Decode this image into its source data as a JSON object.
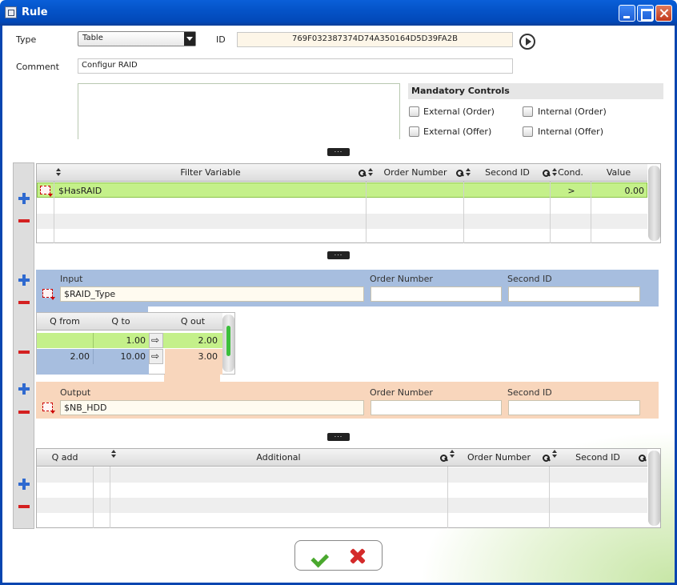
{
  "window": {
    "title": "Rule"
  },
  "form": {
    "type_label": "Type",
    "type_value": "Table",
    "id_label": "ID",
    "id_value": "769F032387374D74A350164D5D39FA2B",
    "comment_label": "Comment",
    "comment_value": "Configur RAID"
  },
  "mandatory": {
    "title": "Mandatory Controls",
    "options": [
      "External (Order)",
      "Internal (Order)",
      "External (Offer)",
      "Internal (Offer)"
    ]
  },
  "filter_grid": {
    "headers": [
      "Filter Variable",
      "Order Number",
      "Second ID",
      "Cond.",
      "Value"
    ],
    "rows": [
      {
        "variable": "$HasRAID",
        "order": "",
        "second": "",
        "cond": ">",
        "value": "0.00"
      }
    ]
  },
  "input_panel": {
    "input_label": "Input",
    "order_label": "Order Number",
    "second_label": "Second ID",
    "input_value": "$RAID_Type"
  },
  "q_table": {
    "headers": [
      "Q from",
      "Q to",
      "Q out"
    ],
    "rows": [
      {
        "from": "",
        "to": "1.00",
        "out": "2.00"
      },
      {
        "from": "2.00",
        "to": "10.00",
        "out": "3.00"
      }
    ]
  },
  "output_panel": {
    "output_label": "Output",
    "order_label": "Order Number",
    "second_label": "Second ID",
    "output_value": "$NB_HDD"
  },
  "additional_grid": {
    "headers": [
      "Q add",
      "Additional",
      "Order Number",
      "Second ID"
    ]
  },
  "colors": {
    "title_blue": "#0453c8",
    "row_selected": "#c4f08a",
    "input_panel": "#a7bedf",
    "output_panel": "#f8d6bc",
    "q_selected": "#c4f08a",
    "q_row2_left": "#a7bedf",
    "q_out_bg": "#f8d6bc"
  },
  "icons": [
    "rule-window-icon",
    "play-icon",
    "add-icon",
    "remove-icon",
    "key-icon",
    "sort-icon",
    "row-marker-icon",
    "arrow-right-icon",
    "ok-icon",
    "cancel-icon",
    "collapse-icon"
  ]
}
